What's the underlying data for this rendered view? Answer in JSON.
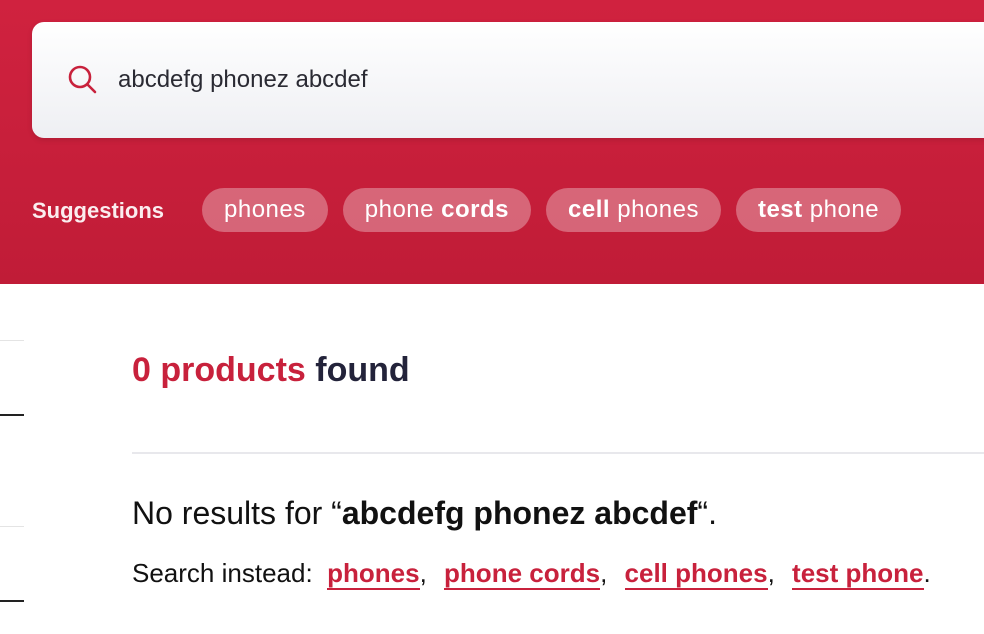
{
  "search": {
    "query": "abcdefg phonez abcdef",
    "icon": "search-icon"
  },
  "suggestions": {
    "label": "Suggestions",
    "chips": [
      {
        "plain_before": "phones",
        "bold": "",
        "plain_after": ""
      },
      {
        "plain_before": "phone ",
        "bold": "cords",
        "plain_after": ""
      },
      {
        "plain_before": "",
        "bold": "cell",
        "plain_after": " phones"
      },
      {
        "plain_before": "",
        "bold": "test",
        "plain_after": " phone"
      }
    ]
  },
  "results": {
    "count_highlight": "0 products",
    "count_rest": " found",
    "no_results_prefix": "No results for “",
    "no_results_query": "abcdefg phonez abcdef",
    "no_results_suffix": "“.",
    "instead_label": "Search instead:",
    "instead_links": [
      "phones",
      "phone cords",
      "cell phones",
      "test phone"
    ],
    "separator": ",",
    "end_punct": "."
  },
  "colors": {
    "brand": "#c8213c",
    "header_top": "#d0223f",
    "header_bottom": "#c01c37",
    "text_dark": "#23233a"
  }
}
